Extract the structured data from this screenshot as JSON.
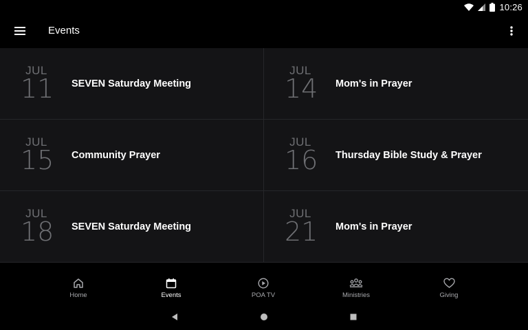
{
  "status_bar": {
    "time": "10:26"
  },
  "app_bar": {
    "title": "Events"
  },
  "events": [
    {
      "month": "JUL",
      "day": "11",
      "title": "SEVEN Saturday Meeting"
    },
    {
      "month": "JUL",
      "day": "14",
      "title": "Mom's in Prayer"
    },
    {
      "month": "JUL",
      "day": "15",
      "title": "Community Prayer"
    },
    {
      "month": "JUL",
      "day": "16",
      "title": "Thursday Bible Study & Prayer"
    },
    {
      "month": "JUL",
      "day": "18",
      "title": "SEVEN Saturday Meeting"
    },
    {
      "month": "JUL",
      "day": "21",
      "title": "Mom's in Prayer"
    }
  ],
  "bottom_nav": {
    "items": [
      {
        "label": "Home",
        "icon": "home-icon"
      },
      {
        "label": "Events",
        "icon": "calendar-icon",
        "active": true
      },
      {
        "label": "POA TV",
        "icon": "play-circle-icon"
      },
      {
        "label": "Ministries",
        "icon": "people-group-icon"
      },
      {
        "label": "Giving",
        "icon": "heart-icon"
      }
    ]
  },
  "colors": {
    "background": "#000000",
    "card_background": "#141416",
    "divider": "#26272a",
    "date_text": "#6e6f73",
    "nav_inactive": "#a8a9ad",
    "nav_active": "#ffffff"
  }
}
